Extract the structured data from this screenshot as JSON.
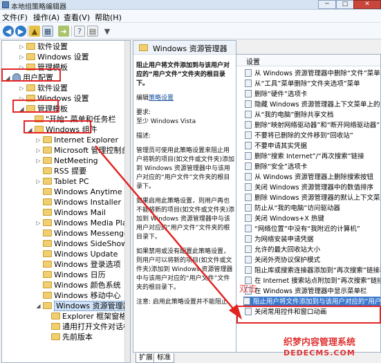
{
  "window": {
    "title": "本地组策略编辑器",
    "controls": {
      "minimize": "─",
      "maximize": "□",
      "close": "✕"
    }
  },
  "menu": [
    "文件(F)",
    "操作(A)",
    "查看(V)",
    "帮助(H)"
  ],
  "tree": [
    {
      "label": "软件设置",
      "exp": "▷",
      "icon": "folder-icon"
    },
    {
      "label": "Windows 设置",
      "exp": "▷",
      "icon": "folder-icon"
    },
    {
      "label": "管理模板",
      "exp": "▷",
      "icon": "folder-icon"
    },
    {
      "label": "用户配置",
      "exp": "◢",
      "icon": "user-icon"
    },
    {
      "label": "软件设置",
      "exp": "▷",
      "icon": "folder-icon"
    },
    {
      "label": "Windows 设置",
      "exp": "▷",
      "icon": "folder-icon"
    },
    {
      "label": "管理模板",
      "exp": "◢",
      "icon": "folder-icon"
    },
    {
      "label": "\"开始\" 菜单和任务栏",
      "exp": "",
      "icon": "folder-icon"
    },
    {
      "label": "Windows 组件",
      "exp": "◢",
      "icon": "folder-icon"
    },
    {
      "label": "Internet Explorer",
      "exp": "▷",
      "icon": "folder-icon"
    },
    {
      "label": "Microsoft 管理控制台",
      "exp": "▷",
      "icon": "folder-icon"
    },
    {
      "label": "NetMeeting",
      "exp": "▷",
      "icon": "folder-icon"
    },
    {
      "label": "RSS 提要",
      "exp": "",
      "icon": "folder-icon"
    },
    {
      "label": "Tablet PC",
      "exp": "▷",
      "icon": "folder-icon"
    },
    {
      "label": "Windows Anytime Upgr",
      "exp": "",
      "icon": "folder-icon"
    },
    {
      "label": "Windows Installer",
      "exp": "",
      "icon": "folder-icon"
    },
    {
      "label": "Windows Mail",
      "exp": "",
      "icon": "folder-icon"
    },
    {
      "label": "Windows Media Player",
      "exp": "▷",
      "icon": "folder-icon"
    },
    {
      "label": "Windows Messenger",
      "exp": "",
      "icon": "folder-icon"
    },
    {
      "label": "Windows SideShow",
      "exp": "",
      "icon": "folder-icon"
    },
    {
      "label": "Windows Update",
      "exp": "",
      "icon": "folder-icon"
    },
    {
      "label": "Windows 登录选项",
      "exp": "",
      "icon": "folder-icon"
    },
    {
      "label": "Windows 日历",
      "exp": "",
      "icon": "folder-icon"
    },
    {
      "label": "Windows 颜色系统",
      "exp": "",
      "icon": "folder-icon"
    },
    {
      "label": "Windows 移动中心",
      "exp": "",
      "icon": "folder-icon"
    },
    {
      "label": "Windows 资源管理器",
      "exp": "◢",
      "icon": "folder-icon"
    },
    {
      "label": "Explorer 框架窗格",
      "exp": "",
      "icon": "folder-icon"
    },
    {
      "label": "通用打开文件对话框",
      "exp": "",
      "icon": "folder-icon"
    },
    {
      "label": "先前版本",
      "exp": "",
      "icon": "folder-icon"
    }
  ],
  "details": {
    "header": "Windows 资源管理器",
    "policy_title": "阻止用户将文件添加到与该用户对应的“用户文件”文件夹的根目录下。",
    "edit_prefix": "编辑",
    "edit_link": "策略设置",
    "requirements_label": "要求:",
    "requirements_value": "至少 Windows Vista",
    "desc_label": "描述:",
    "desc_1": "管理员可使用此策略设置来阻止用户将新的项目(如文件或文件夹)添加到 Windows 资源管理器中与该用户对应的“用户文件”文件夹的根目录下。",
    "desc_2": "如果启用此策略设置，则用户再也不能将新的项目(如文件或文件夹)添加到 Windows 资源管理器中与该用户对应的“用户文件”文件夹的根目录下。",
    "desc_3": "如果禁用或没有配置此策略设置，则用户可以将新的项目(如文件或文件夹)添加到 Windows 资源管理器中与该用户对应的“用户文件”文件夹的根目录下。",
    "note": "注意: 启用此策略设置并不能阻止"
  },
  "list": {
    "column_header": "设置",
    "items": [
      "从 Windows 资源管理器中删除“文件”菜单",
      "从“工具”菜单删除“文件夹选项”菜单",
      "删除“硬件”选项卡",
      "隐藏 Windows 资源管理器上下文菜单上的“管理”项",
      "从“我的电脑”删除共享文档",
      "删除“映射网络驱动器”和“断开网络驱动器”",
      "不要将已删除的文件移到“回收站”",
      "不要申请其实凭据",
      "删除“搜索 Internet”/“再次搜索”链接",
      "删除“安全”选项卡",
      "从 Windows 资源管理器上删除搜索按钮",
      "关闭 Windows 资源管理器中的数值排序",
      "删除 Windows 资源管理器的默认上下文菜单",
      "防止从“我的电脑”访问驱动器",
      "关闭 Windows+X 热键",
      "“网络位置”中没有“我附近的计算机”",
      "为网络安装申请凭据",
      "允许的最大回收站大小",
      "关闭外壳协议保护模式",
      "阻止库或搜索连接器添加到“再次搜索”链接和“开始”菜单",
      "在 Internet 搜索站点附加到“再次搜索”链接",
      "在 Windows 资源管理器中显示菜单栏",
      "阻止用户将文件添加到与该用户对应的“用户文件”文件夹的根目录下。",
      "关闭常用控件和窗口动画"
    ],
    "selected_index": 22
  },
  "tabs": [
    "扩展",
    "标准"
  ],
  "overlay_text": "双击",
  "watermark": {
    "line1": "织梦内容管理系统",
    "line2": "DEDECMS.COM"
  },
  "colors": {
    "highlight": "#e32222",
    "selection": "#3a78cf",
    "folder": "#efcf72"
  }
}
